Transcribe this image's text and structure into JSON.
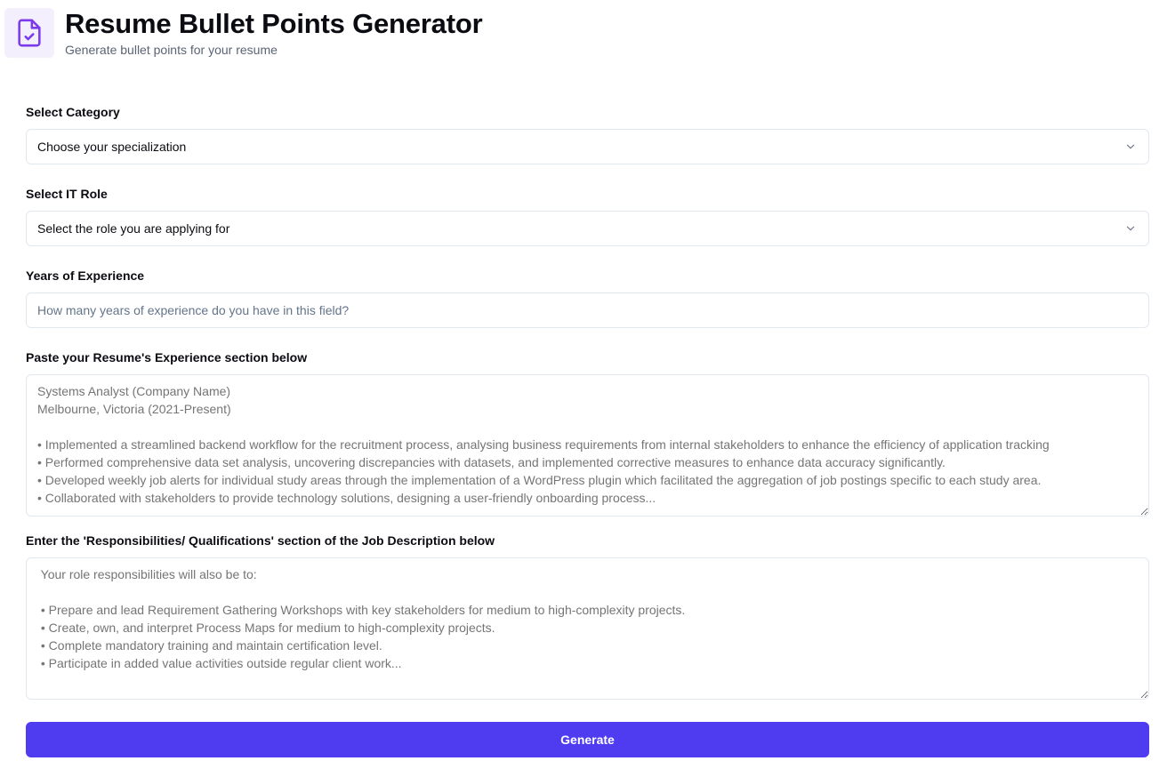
{
  "header": {
    "title": "Resume Bullet Points Generator",
    "subtitle": "Generate bullet points for your resume",
    "icon": "file-check-icon",
    "accent_color": "#7c3aed"
  },
  "form": {
    "category": {
      "label": "Select Category",
      "selected_value": "Choose your specialization"
    },
    "role": {
      "label": "Select IT Role",
      "selected_value": "Select the role you are applying for"
    },
    "experience_years": {
      "label": "Years of Experience",
      "placeholder": "How many years of experience do you have in this field?",
      "value": ""
    },
    "resume_experience": {
      "label": "Paste your Resume's Experience section below",
      "placeholder": "Systems Analyst (Company Name)\nMelbourne, Victoria (2021-Present)\n\n• Implemented a streamlined backend workflow for the recruitment process, analysing business requirements from internal stakeholders to enhance the efficiency of application tracking\n• Performed comprehensive data set analysis, uncovering discrepancies with datasets, and implemented corrective measures to enhance data accuracy significantly.\n• Developed weekly job alerts for individual study areas through the implementation of a WordPress plugin which facilitated the aggregation of job postings specific to each study area.\n• Collaborated with stakeholders to provide technology solutions, designing a user-friendly onboarding process..."
    },
    "job_description": {
      "label": "Enter the 'Responsibilities/ Qualifications' section of the Job Description below",
      "placeholder": " Your role responsibilities will also be to:\n\n • Prepare and lead Requirement Gathering Workshops with key stakeholders for medium to high-complexity projects.\n • Create, own, and interpret Process Maps for medium to high-complexity projects.\n • Complete mandatory training and maintain certification level.\n • Participate in added value activities outside regular client work..."
    },
    "generate_label": "Generate",
    "button_color": "#4f3bf0"
  }
}
